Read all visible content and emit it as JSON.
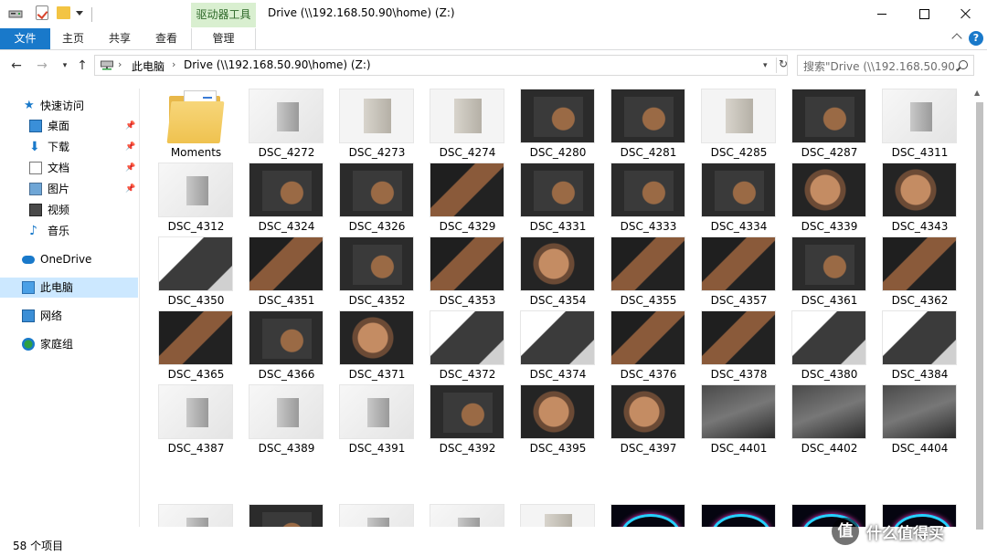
{
  "titlebar": {
    "context_tab": "驱动器工具",
    "title": "Drive (\\\\192.168.50.90\\home) (Z:)"
  },
  "ribbon": {
    "file": "文件",
    "home": "主页",
    "share": "共享",
    "view": "查看",
    "manage": "管理",
    "help": "?"
  },
  "address": {
    "this_pc": "此电脑",
    "current": "Drive (\\\\192.168.50.90\\home) (Z:)",
    "separator": "›"
  },
  "search": {
    "placeholder": "搜索\"Drive (\\\\192.168.50.90..."
  },
  "sidebar": {
    "items": [
      {
        "label": "快速访问",
        "icon": "star-icon"
      },
      {
        "label": "桌面",
        "icon": "desktop-icon",
        "pinned": true
      },
      {
        "label": "下载",
        "icon": "download-icon",
        "pinned": true
      },
      {
        "label": "文档",
        "icon": "documents-icon",
        "pinned": true
      },
      {
        "label": "图片",
        "icon": "pictures-icon",
        "pinned": true
      },
      {
        "label": "视频",
        "icon": "video-icon"
      },
      {
        "label": "音乐",
        "icon": "music-icon"
      },
      {
        "label": "OneDrive",
        "icon": "cloud-icon"
      },
      {
        "label": "此电脑",
        "icon": "computer-icon",
        "selected": true
      },
      {
        "label": "网络",
        "icon": "network-icon"
      },
      {
        "label": "家庭组",
        "icon": "homegroup-icon"
      }
    ]
  },
  "files": [
    {
      "name": "Moments",
      "kind": "folder"
    },
    {
      "name": "DSC_4272",
      "kind": "white"
    },
    {
      "name": "DSC_4273",
      "kind": "silver"
    },
    {
      "name": "DSC_4274",
      "kind": "silver"
    },
    {
      "name": "DSC_4280",
      "kind": "dark"
    },
    {
      "name": "DSC_4281",
      "kind": "dark"
    },
    {
      "name": "DSC_4285",
      "kind": "silver"
    },
    {
      "name": "DSC_4287",
      "kind": "dark"
    },
    {
      "name": "DSC_4311",
      "kind": "white"
    },
    {
      "name": "DSC_4312",
      "kind": "white"
    },
    {
      "name": "DSC_4324",
      "kind": "dark"
    },
    {
      "name": "DSC_4326",
      "kind": "dark"
    },
    {
      "name": "DSC_4329",
      "kind": "copper"
    },
    {
      "name": "DSC_4331",
      "kind": "dark"
    },
    {
      "name": "DSC_4333",
      "kind": "dark"
    },
    {
      "name": "DSC_4334",
      "kind": "dark"
    },
    {
      "name": "DSC_4339",
      "kind": "copper2"
    },
    {
      "name": "DSC_4343",
      "kind": "copper2"
    },
    {
      "name": "DSC_4350",
      "kind": "light"
    },
    {
      "name": "DSC_4351",
      "kind": "copper"
    },
    {
      "name": "DSC_4352",
      "kind": "dark"
    },
    {
      "name": "DSC_4353",
      "kind": "copper"
    },
    {
      "name": "DSC_4354",
      "kind": "copper2"
    },
    {
      "name": "DSC_4355",
      "kind": "copper"
    },
    {
      "name": "DSC_4357",
      "kind": "copper"
    },
    {
      "name": "DSC_4361",
      "kind": "dark"
    },
    {
      "name": "DSC_4362",
      "kind": "copper"
    },
    {
      "name": "DSC_4365",
      "kind": "copper"
    },
    {
      "name": "DSC_4366",
      "kind": "dark"
    },
    {
      "name": "DSC_4371",
      "kind": "copper2"
    },
    {
      "name": "DSC_4372",
      "kind": "light"
    },
    {
      "name": "DSC_4374",
      "kind": "light"
    },
    {
      "name": "DSC_4376",
      "kind": "copper"
    },
    {
      "name": "DSC_4378",
      "kind": "copper"
    },
    {
      "name": "DSC_4380",
      "kind": "light"
    },
    {
      "name": "DSC_4384",
      "kind": "light"
    },
    {
      "name": "DSC_4387",
      "kind": "white"
    },
    {
      "name": "DSC_4389",
      "kind": "white"
    },
    {
      "name": "DSC_4391",
      "kind": "white"
    },
    {
      "name": "DSC_4392",
      "kind": "dark"
    },
    {
      "name": "DSC_4395",
      "kind": "copper2"
    },
    {
      "name": "DSC_4397",
      "kind": "copper2"
    },
    {
      "name": "DSC_4401",
      "kind": "glass"
    },
    {
      "name": "DSC_4402",
      "kind": "glass"
    },
    {
      "name": "DSC_4404",
      "kind": "glass"
    },
    {
      "name": "",
      "kind": "white"
    },
    {
      "name": "",
      "kind": "dark"
    },
    {
      "name": "",
      "kind": "white"
    },
    {
      "name": "",
      "kind": "white"
    },
    {
      "name": "",
      "kind": "silver"
    },
    {
      "name": "",
      "kind": "neon"
    },
    {
      "name": "",
      "kind": "neon"
    },
    {
      "name": "",
      "kind": "neon"
    },
    {
      "name": "",
      "kind": "neon"
    }
  ],
  "status": {
    "count": "58 个项目"
  },
  "watermark": {
    "badge": "值",
    "text": "什么值得买"
  },
  "colors": {
    "accent": "#1979ca",
    "context_tab_bg": "#d9efd0",
    "selected_bg": "#cce8ff"
  }
}
